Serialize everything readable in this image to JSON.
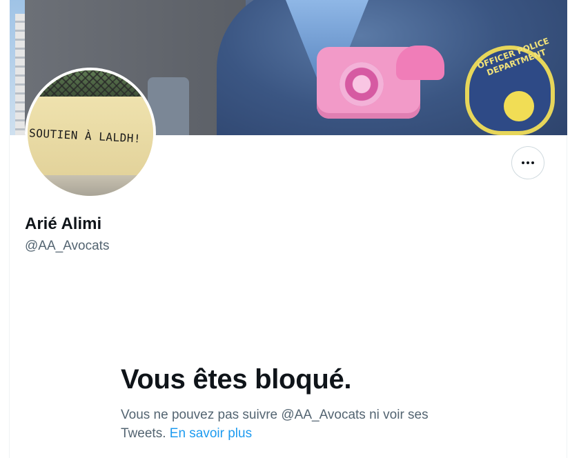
{
  "profile": {
    "display_name": "Arié Alimi",
    "handle": "@AA_Avocats"
  },
  "banner": {
    "badge_text": "OFFICER POLICE DEPARTMENT"
  },
  "avatar": {
    "graffiti_text": "SOUTIEN À LALDH!"
  },
  "actions": {
    "more_icon": "more-horizontal-icon"
  },
  "blocked": {
    "title": "Vous êtes bloqué.",
    "description": "Vous ne pouvez pas suivre @AA_Avocats ni voir ses Tweets.",
    "link_label": "En savoir plus"
  },
  "colors": {
    "accent": "#1d9bf0",
    "text_primary": "#0f1419",
    "text_secondary": "#536471",
    "border": "#cfd9de"
  }
}
